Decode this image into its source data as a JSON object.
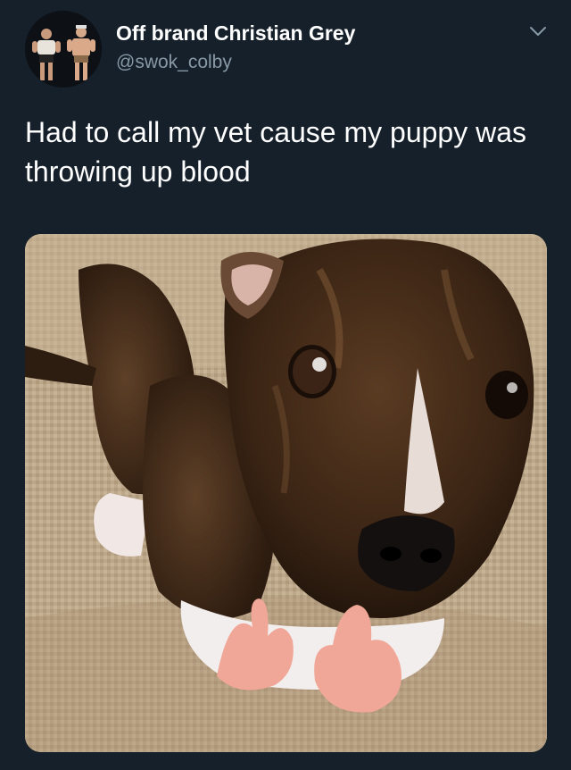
{
  "tweet": {
    "display_name": "Off brand Christian Grey",
    "handle": "@swok_colby",
    "text": "Had to call my vet cause my puppy was throwing up blood",
    "avatar_icon": "avatar-photo",
    "menu_icon": "chevron-down-icon",
    "media_description_icon": "puppy-photo"
  },
  "colors": {
    "background": "#15202b",
    "primary_text": "#ffffff",
    "secondary_text": "#8899a6"
  }
}
